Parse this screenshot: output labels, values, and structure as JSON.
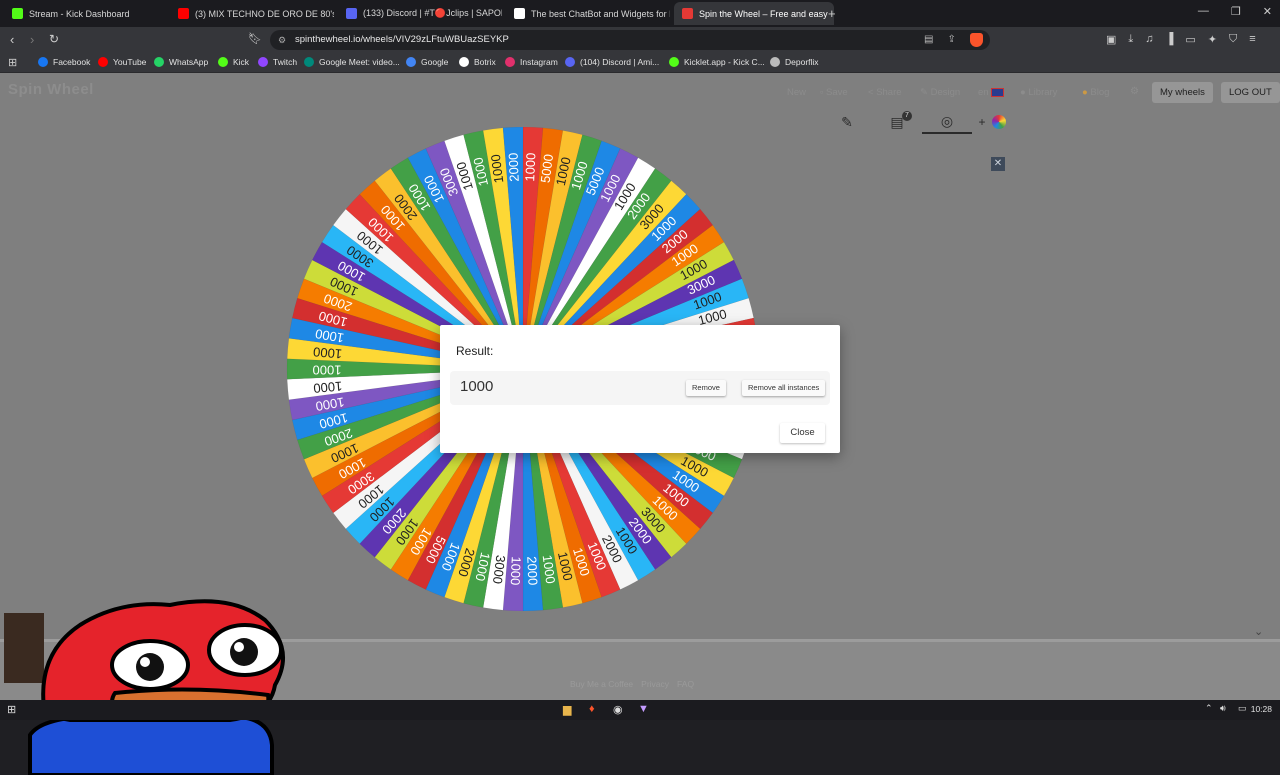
{
  "browser": {
    "tabs": [
      {
        "title": "Stream - Kick Dashboard",
        "icon": "kick-icon",
        "color": "#53fc18"
      },
      {
        "title": "(3) MIX TECHNO DE ORO DE 80's & 90",
        "icon": "youtube-icon",
        "color": "#ff0000"
      },
      {
        "title": "(133) Discord | #T🔴Jclips | SAPOLIC",
        "icon": "discord-icon",
        "color": "#5865f2"
      },
      {
        "title": "The best ChatBot and Widgets for Ki",
        "icon": "botrix-icon",
        "color": "#ffffff"
      },
      {
        "title": "Spin the Wheel – Free and easy",
        "icon": "spinthewheel-icon",
        "color": "#e53935",
        "active": true
      }
    ],
    "url": "spinthewheel.io/wheels/VIV29zLFtuWBUazSEYKP",
    "bookmarks": [
      {
        "label": "Facebook",
        "color": "#1877f2"
      },
      {
        "label": "YouTube",
        "color": "#ff0000"
      },
      {
        "label": "WhatsApp",
        "color": "#25d366"
      },
      {
        "label": "Kick",
        "color": "#53fc18"
      },
      {
        "label": "Twitch",
        "color": "#9146ff"
      },
      {
        "label": "Google Meet: video...",
        "color": "#00897b"
      },
      {
        "label": "Google",
        "color": "#4285f4"
      },
      {
        "label": "Botrix",
        "color": "#ffffff"
      },
      {
        "label": "Instagram",
        "color": "#e1306c"
      },
      {
        "label": "(104) Discord | Ami...",
        "color": "#5865f2"
      },
      {
        "label": "Kicklet.app - Kick C...",
        "color": "#53fc18"
      },
      {
        "label": "Deporflix",
        "color": "#bbbbbb"
      }
    ]
  },
  "site": {
    "logo": "Spin Wheel",
    "nav": {
      "new": "New",
      "save": "Save",
      "share": "Share",
      "design": "Design",
      "language": "en",
      "library": "Library",
      "blog": "Blog",
      "my_wheels": "My wheels",
      "logout": "LOG OUT"
    },
    "toolbar_badge": "7",
    "footer": [
      "Buy Me a Coffee",
      "Privacy",
      "FAQ"
    ]
  },
  "wheel": {
    "colors": [
      "#e53935",
      "#ef6c00",
      "#fbc02d",
      "#43a047",
      "#1e88e5",
      "#7e57c2",
      "#ffffff",
      "#43a047",
      "#fdd835",
      "#1e88e5",
      "#d32f2f",
      "#f57c00",
      "#cddc39",
      "#5e35b1",
      "#29b6f6",
      "#f5f5f5"
    ],
    "labels": [
      "1000",
      "5000",
      "1000",
      "1000",
      "5000",
      "1000",
      "1000",
      "2000",
      "3000",
      "1000",
      "2000",
      "1000",
      "1000",
      "3000",
      "1000",
      "1000",
      "1000",
      "1000",
      "4000",
      "1000",
      "1000",
      "5000",
      "1000",
      "2000",
      "1000",
      "1000",
      "1000",
      "1000",
      "3000",
      "2000",
      "1000",
      "2000",
      "1000",
      "1000",
      "1000",
      "1000",
      "2000",
      "1000",
      "3000",
      "1000",
      "2000",
      "1000",
      "5000",
      "1000",
      "1000",
      "2000",
      "1000",
      "1000",
      "3000",
      "1000",
      "1000",
      "2000",
      "1000",
      "1000",
      "1000",
      "1000",
      "1000",
      "1000",
      "1000",
      "2000",
      "1000",
      "1000",
      "3000",
      "1000",
      "1000",
      "1000",
      "2000",
      "1000",
      "1000",
      "3000",
      "1000",
      "1000",
      "1000",
      "2000"
    ]
  },
  "dialog": {
    "title": "Result:",
    "value": "1000",
    "remove": "Remove",
    "remove_all": "Remove all instances",
    "close": "Close"
  },
  "taskbar": {
    "time": "10:28"
  }
}
